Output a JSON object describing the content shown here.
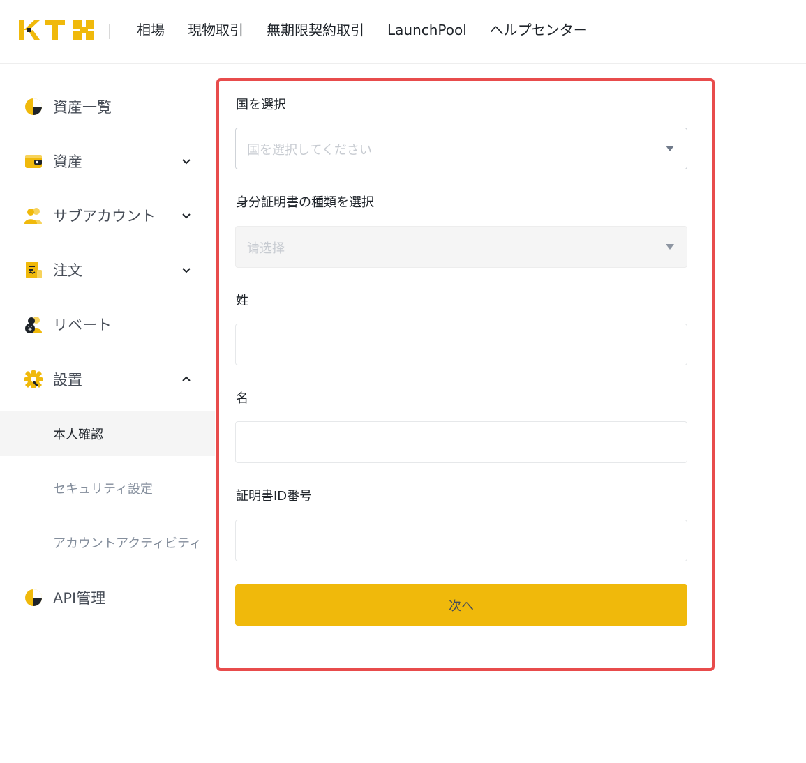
{
  "header": {
    "nav": [
      "相場",
      "現物取引",
      "無期限契約取引",
      "LaunchPool",
      "ヘルプセンター"
    ]
  },
  "sidebar": {
    "items": [
      {
        "label": "資産一覧",
        "icon": "pie-chart-icon",
        "expandable": false
      },
      {
        "label": "資産",
        "icon": "wallet-icon",
        "expandable": true,
        "expanded": false
      },
      {
        "label": "サブアカウント",
        "icon": "users-icon",
        "expandable": true,
        "expanded": false
      },
      {
        "label": "注文",
        "icon": "receipt-icon",
        "expandable": true,
        "expanded": false
      },
      {
        "label": "リベート",
        "icon": "rebate-users-icon",
        "expandable": false
      },
      {
        "label": "設置",
        "icon": "settings-gear-icon",
        "expandable": true,
        "expanded": true
      },
      {
        "label": "API管理",
        "icon": "pie-chart-icon",
        "expandable": false
      }
    ],
    "settings_sub": [
      "本人確認",
      "セキュリティ設定",
      "アカウントアクティビティ"
    ],
    "active_sub": "本人確認"
  },
  "form": {
    "country_label": "国を選択",
    "country_placeholder": "国を選択してください",
    "id_type_label": "身分証明書の種類を選択",
    "id_type_placeholder": "请选择",
    "last_name_label": "姓",
    "last_name_value": "",
    "first_name_label": "名",
    "first_name_value": "",
    "id_number_label": "証明書ID番号",
    "id_number_value": "",
    "next_button": "次へ"
  },
  "colors": {
    "brand_yellow": "#f0b90b",
    "highlight_border": "#e84c4c"
  }
}
